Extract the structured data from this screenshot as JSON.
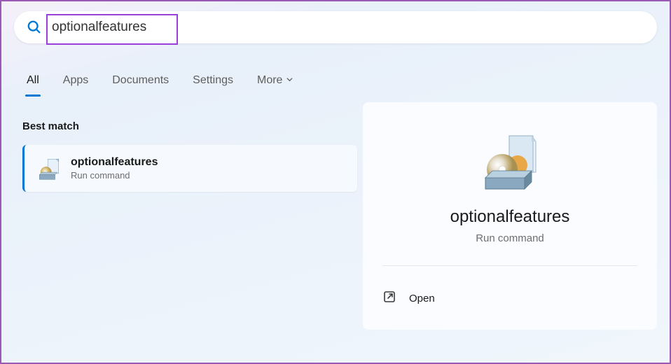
{
  "search": {
    "value": "optionalfeatures"
  },
  "tabs": {
    "all": "All",
    "apps": "Apps",
    "documents": "Documents",
    "settings": "Settings",
    "more": "More"
  },
  "section_title": "Best match",
  "result": {
    "title": "optionalfeatures",
    "subtitle": "Run command"
  },
  "detail": {
    "title": "optionalfeatures",
    "subtitle": "Run command"
  },
  "actions": {
    "open": "Open"
  }
}
